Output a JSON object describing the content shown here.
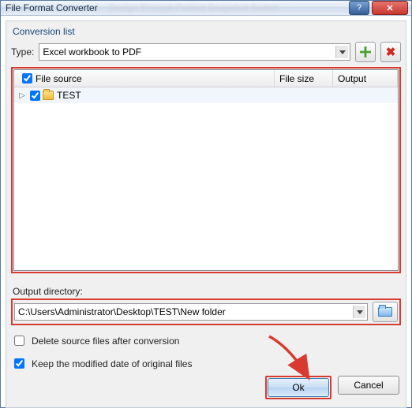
{
  "window": {
    "title": "File Format Converter"
  },
  "win_buttons": {
    "min": "—",
    "help": "?",
    "close": "✕"
  },
  "blurred_menu": "Design  Encrypt  Protect  Snapshot  Switch",
  "group_label": "Conversion list",
  "type_row": {
    "label": "Type:",
    "selected": "Excel workbook to PDF"
  },
  "tree": {
    "columns": [
      "File source",
      "File size",
      "Output"
    ],
    "rows": [
      {
        "checked": true,
        "label": "TEST"
      }
    ]
  },
  "output": {
    "label": "Output directory:",
    "path": "C:\\Users\\Administrator\\Desktop\\TEST\\New folder"
  },
  "options": {
    "delete_label": "Delete source files after conversion",
    "delete_checked": false,
    "keepdate_label": "Keep the modified date of original files",
    "keepdate_checked": true
  },
  "buttons": {
    "ok": "Ok",
    "cancel": "Cancel"
  }
}
